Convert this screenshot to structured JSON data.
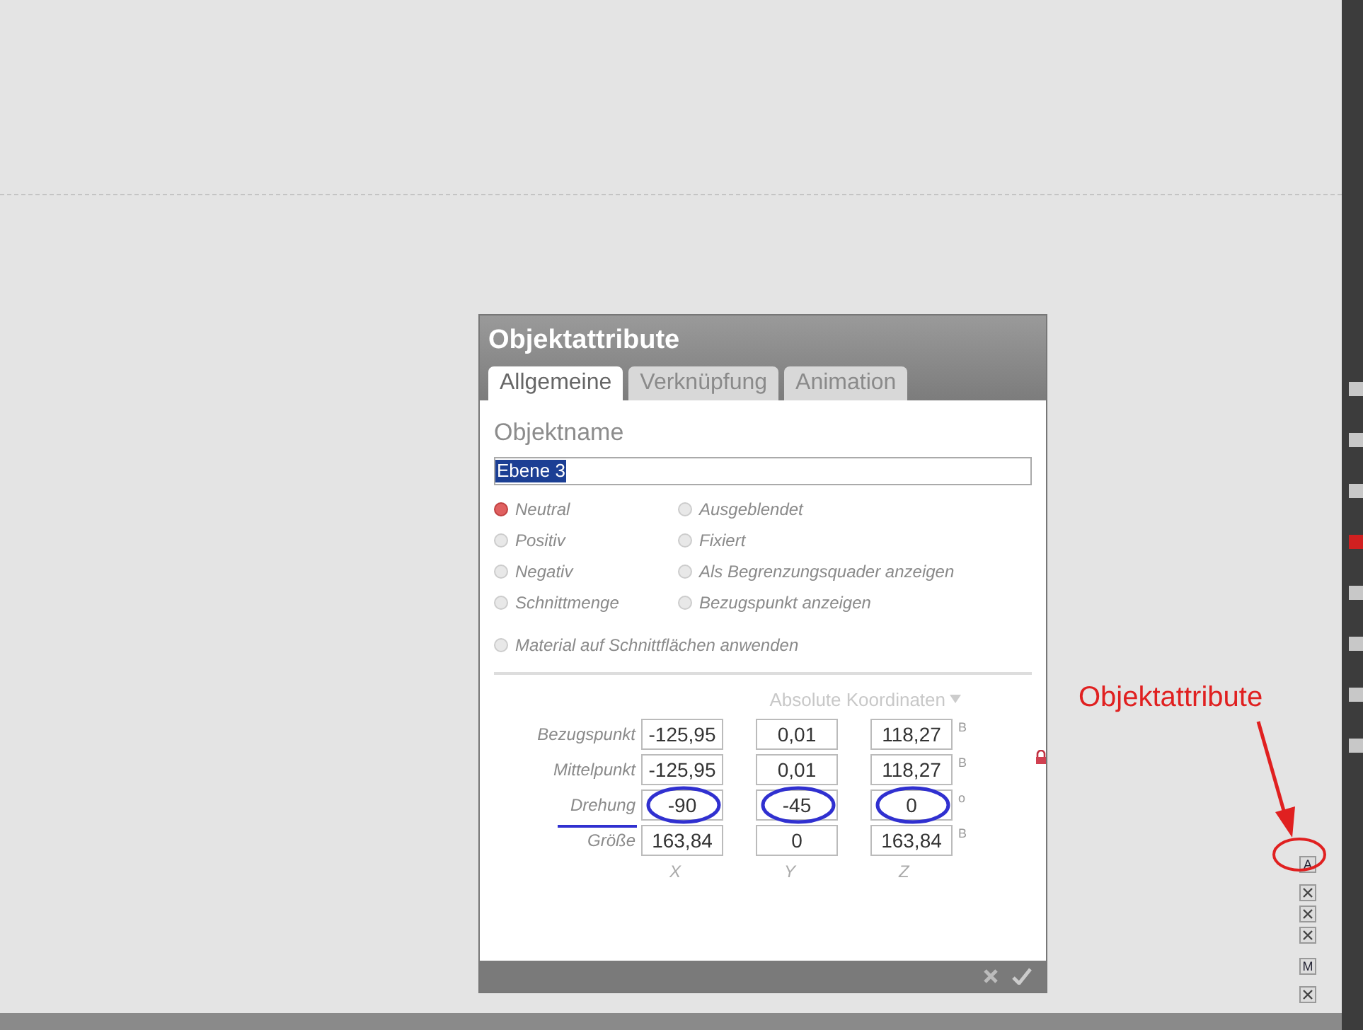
{
  "dialog": {
    "title": "Objektattribute",
    "tabs": [
      {
        "label": "Allgemeine",
        "selected": true
      },
      {
        "label": "Verknüpfung",
        "selected": false
      },
      {
        "label": "Animation",
        "selected": false
      }
    ],
    "name_label": "Objektname",
    "name_value": "Ebene 3",
    "modes": [
      {
        "label": "Neutral",
        "selected": true
      },
      {
        "label": "Positiv",
        "selected": false
      },
      {
        "label": "Negativ",
        "selected": false
      },
      {
        "label": "Schnittmenge",
        "selected": false
      }
    ],
    "flags": [
      {
        "label": "Ausgeblendet",
        "checked": false
      },
      {
        "label": "Fixiert",
        "checked": false
      },
      {
        "label": "Als Begrenzungsquader anzeigen",
        "checked": false
      },
      {
        "label": "Bezugspunkt anzeigen",
        "checked": false
      }
    ],
    "material": {
      "label": "Material auf Schnittflächen anwenden",
      "checked": false
    },
    "coordinates_mode": "Absolute Koordinaten",
    "rows": [
      {
        "label": "Bezugspunkt",
        "values": [
          "-125,95",
          "0,01",
          "118,27"
        ],
        "suffix": "B",
        "circled": false
      },
      {
        "label": "Mittelpunkt",
        "values": [
          "-125,95",
          "0,01",
          "118,27"
        ],
        "suffix": "B",
        "circled": false
      },
      {
        "label": "Drehung",
        "values": [
          "-90",
          "-45",
          "0"
        ],
        "suffix": "o",
        "circled": true
      },
      {
        "label": "Größe",
        "values": [
          "163,84",
          "0",
          "163,84"
        ],
        "suffix": "B",
        "circled": false
      }
    ],
    "locked": true,
    "axes": [
      "X",
      "Y",
      "Z"
    ]
  },
  "annotation": {
    "text": "Objektattribute"
  },
  "tools": [
    {
      "kind": "letter",
      "label": "A",
      "circled": true
    },
    {
      "kind": "icon",
      "circled": false
    },
    {
      "kind": "icon",
      "circled": false
    },
    {
      "kind": "icon",
      "circled": false
    },
    {
      "kind": "letter",
      "label": "M",
      "circled": false
    },
    {
      "kind": "icon",
      "circled": false
    }
  ]
}
